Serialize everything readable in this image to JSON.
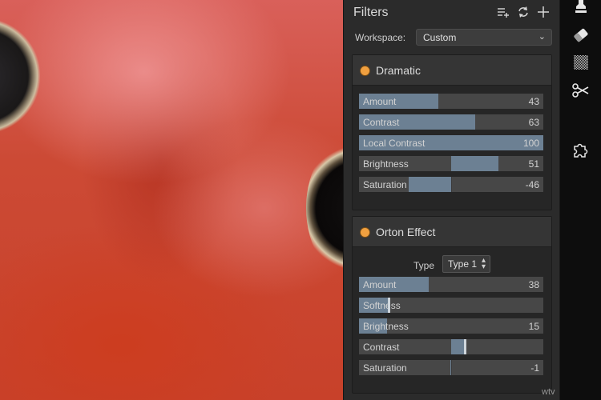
{
  "panel": {
    "title": "Filters",
    "workspace_label": "Workspace:",
    "workspace_value": "Custom"
  },
  "filters": [
    {
      "name": "Dramatic",
      "sliders": [
        {
          "label": "Amount",
          "value": "43",
          "amount": 0.43,
          "mode": "left"
        },
        {
          "label": "Contrast",
          "value": "63",
          "amount": 0.63,
          "mode": "left"
        },
        {
          "label": "Local Contrast",
          "value": "100",
          "amount": 1.0,
          "mode": "left"
        },
        {
          "label": "Brightness",
          "value": "51",
          "amount": 0.51,
          "mode": "center"
        },
        {
          "label": "Saturation",
          "value": "-46",
          "amount": -0.46,
          "mode": "center"
        }
      ]
    },
    {
      "name": "Orton Effect",
      "type_label": "Type",
      "type_value": "Type 1",
      "sliders": [
        {
          "label": "Amount",
          "value": "38",
          "amount": 0.38,
          "mode": "left"
        },
        {
          "label": "Softness",
          "value": "",
          "amount": 0.16,
          "mode": "left"
        },
        {
          "label": "Brightness",
          "value": "15",
          "amount": 0.15,
          "mode": "left"
        },
        {
          "label": "Contrast",
          "value": "",
          "amount": 0.15,
          "mode": "center"
        },
        {
          "label": "Saturation",
          "value": "-1",
          "amount": -0.01,
          "mode": "center"
        }
      ]
    }
  ],
  "icons": {
    "add_preset": "add-list-icon",
    "refresh": "refresh-icon",
    "add_filter": "plus-icon",
    "stamp": "stamp-icon",
    "eraser": "eraser-icon",
    "texture": "noise-pattern-icon",
    "cut": "scissors-icon",
    "plugin": "puzzle-icon"
  },
  "watermark": "wtv",
  "colors": {
    "panel_bg": "#2b2b2b",
    "slider_fill": "#6c8093",
    "filter_dot": "#f0a040",
    "toolbar_bg": "#0d0d0d"
  }
}
